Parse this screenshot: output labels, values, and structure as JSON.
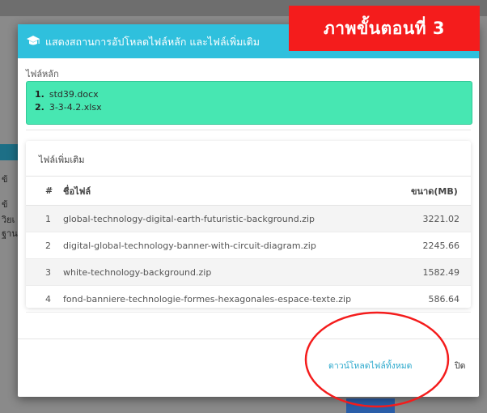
{
  "background": {
    "left_fragments": [
      "ข้",
      "ข้",
      "วิยเ",
      "ฐาน"
    ]
  },
  "modal": {
    "title": "แสดงสถานการอัปโหลดไฟล์หลัก และไฟล์เพิ่มเติม",
    "title_icon": "graduation-cap-icon",
    "header_color": "#2fc0dd",
    "main_files_label": "ไฟล์หลัก",
    "main_files_color": "#47e7b2",
    "main_files": [
      {
        "num": "1.",
        "name": "std39.docx"
      },
      {
        "num": "2.",
        "name": "3-3-4.2.xlsx"
      }
    ],
    "extra_files_label": "ไฟล์เพิ่มเติม",
    "table": {
      "headers": {
        "num": "#",
        "name": "ชื่อไฟล์",
        "size": "ขนาด(MB)"
      },
      "rows": [
        {
          "num": "1",
          "name": "global-technology-digital-earth-futuristic-background.zip",
          "size": "3221.02"
        },
        {
          "num": "2",
          "name": "digital-global-technology-banner-with-circuit-diagram.zip",
          "size": "2245.66"
        },
        {
          "num": "3",
          "name": "white-technology-background.zip",
          "size": "1582.49"
        },
        {
          "num": "4",
          "name": "fond-banniere-technologie-formes-hexagonales-espace-texte.zip",
          "size": "586.64"
        }
      ]
    },
    "download_all_label": "ดาวน์โหลดไฟล์ทั้งหมด",
    "close_label": "ปิด"
  },
  "annotation": {
    "step_label": "ภาพขั้นตอนที่ 3",
    "color": "#f41c1c"
  }
}
